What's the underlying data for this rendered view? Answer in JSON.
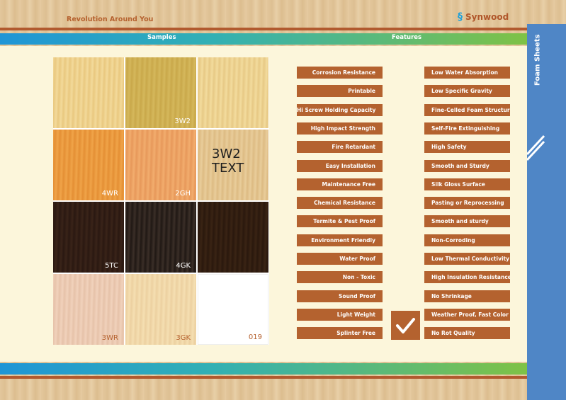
{
  "header": {
    "tagline": "Revolution Around You",
    "brand": "Synwood"
  },
  "bands": {
    "samples_label": "Samples",
    "features_label": "Features"
  },
  "side_tab": {
    "label": "Foam Sheets"
  },
  "samples": [
    {
      "code": "",
      "color_a": "#f3da9b",
      "color_b": "#e9c87f"
    },
    {
      "code": "3W2",
      "color_a": "#d5b85c",
      "color_b": "#c9a84a"
    },
    {
      "code": "",
      "color_a": "#f3dc9e",
      "color_b": "#e7c985"
    },
    {
      "code": "4WR",
      "color_a": "#f0a449",
      "color_b": "#e48f34"
    },
    {
      "code": "2GH",
      "color_a": "#f2ad6e",
      "color_b": "#e7985a"
    },
    {
      "code": "3W2 TEXT",
      "color_a": "#e9cd9b",
      "color_b": "#ddbb83"
    },
    {
      "code": "5TC",
      "color_a": "#3a2419",
      "color_b": "#2a1811"
    },
    {
      "code": "4GK",
      "color_a": "#3b2f28",
      "color_b": "#201814"
    },
    {
      "code": "",
      "color_a": "#3a2414",
      "color_b": "#2a180d"
    },
    {
      "code": "3WR",
      "color_a": "#f1d2bc",
      "color_b": "#e6c2a9"
    },
    {
      "code": "3GK",
      "color_a": "#f5dfb2",
      "color_b": "#ecd0a0"
    },
    {
      "code": "019",
      "color_a": "#ffffff",
      "color_b": "#ffffff"
    }
  ],
  "features_left": [
    "Corrosion Resistance",
    "Printable",
    "Hi Screw Holding Capacity",
    "High Impact Strength",
    "Fire Retardant",
    "Easy Installation",
    "Maintenance Free",
    "Chemical Resistance",
    "Termite & Pest Proof",
    "Environment Friendly",
    "Water Proof",
    "Non - Toxic",
    "Sound Proof",
    "Light Weight",
    "Splinter Free"
  ],
  "features_right": [
    "Low Water Absorption",
    "Low Specific Gravity",
    "Fine-Celled Foam Structure",
    "Self-Fire Extinguishing",
    "High Safety",
    "Smooth and Sturdy",
    "Silk Gloss Surface",
    "Pasting or Reprocessing",
    "Smooth and sturdy",
    "Non-Corroding",
    "Low Thermal Conductivity",
    "High Insulation Resistance",
    "No Shrinkage",
    "Weather Proof, Fast Color",
    "No Rot Quality"
  ],
  "colors": {
    "accent": "#b4622f",
    "panel": "#fcf6db",
    "side_tab": "#4f86c6"
  }
}
